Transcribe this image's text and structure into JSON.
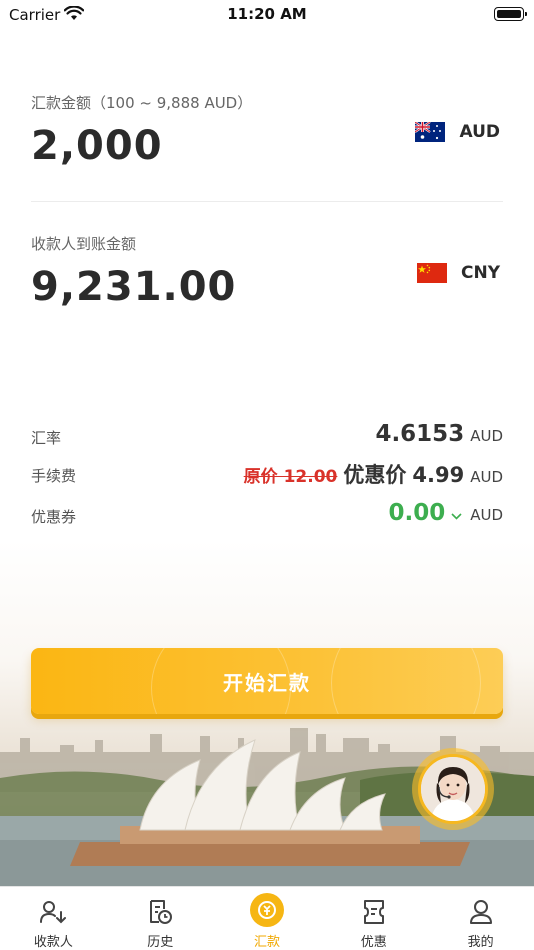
{
  "status_bar": {
    "carrier": "Carrier",
    "time": "11:20 AM"
  },
  "send": {
    "label": "汇款金额（100 ~ 9,888 AUD）",
    "amount": "2,000",
    "currency": "AUD",
    "flag_icon": "australia-flag-icon"
  },
  "receive": {
    "label": "收款人到账金额",
    "amount": "9,231.00",
    "currency": "CNY",
    "flag_icon": "china-flag-icon"
  },
  "details": {
    "rate": {
      "label": "汇率",
      "value": "4.6153",
      "unit": "AUD"
    },
    "fee": {
      "label": "手续费",
      "original": "原价 12.00",
      "discount_label": "优惠价",
      "discount_value": "4.99",
      "unit": "AUD"
    },
    "coupon": {
      "label": "优惠券",
      "value": "0.00",
      "unit": "AUD",
      "icon": "chevron-down-icon"
    }
  },
  "actions": {
    "start_label": "开始汇款"
  },
  "colors": {
    "accent": "#f6b613",
    "discount_red": "#d9322a",
    "coupon_green": "#3dae4f"
  },
  "tabs": [
    {
      "label": "收款人",
      "icon": "payee-icon",
      "active": false
    },
    {
      "label": "历史",
      "icon": "history-icon",
      "active": false
    },
    {
      "label": "汇款",
      "icon": "remit-icon",
      "active": true
    },
    {
      "label": "优惠",
      "icon": "coupon-icon",
      "active": false
    },
    {
      "label": "我的",
      "icon": "profile-icon",
      "active": false
    }
  ]
}
